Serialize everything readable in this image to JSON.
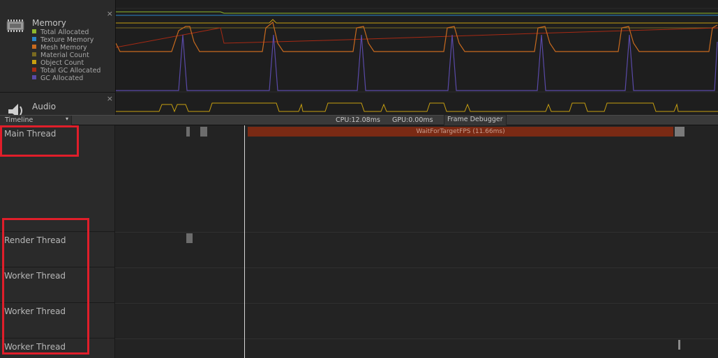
{
  "memory_module": {
    "title": "Memory",
    "icon": "memory-chip-icon",
    "close": "×",
    "legend": [
      {
        "label": "Total Allocated",
        "color": "#8fb82c"
      },
      {
        "label": "Texture Memory",
        "color": "#2a86c8"
      },
      {
        "label": "Mesh Memory",
        "color": "#c86a1e"
      },
      {
        "label": "Material Count",
        "color": "#7a6a20"
      },
      {
        "label": "Object Count",
        "color": "#c8a010"
      },
      {
        "label": "Total GC Allocated",
        "color": "#a82a14"
      },
      {
        "label": "GC Allocated",
        "color": "#5a4aa8"
      }
    ]
  },
  "audio_module": {
    "title": "Audio",
    "icon": "speaker-icon",
    "close": "×"
  },
  "toolbar": {
    "view_mode": "Timeline",
    "view_caret": "▾",
    "cpu": "CPU:12.08ms",
    "gpu": "GPU:0.00ms",
    "frame_debugger": "Frame Debugger"
  },
  "threads": [
    "Main Thread",
    "Render Thread",
    "Worker Thread",
    "Worker Thread",
    "Worker Thread"
  ],
  "main_sample": {
    "label": "WaitForTargetFPS (11.66ms)"
  },
  "colors": {
    "highlight": "#e01e2a",
    "wait_bar": "#7a2a14"
  }
}
